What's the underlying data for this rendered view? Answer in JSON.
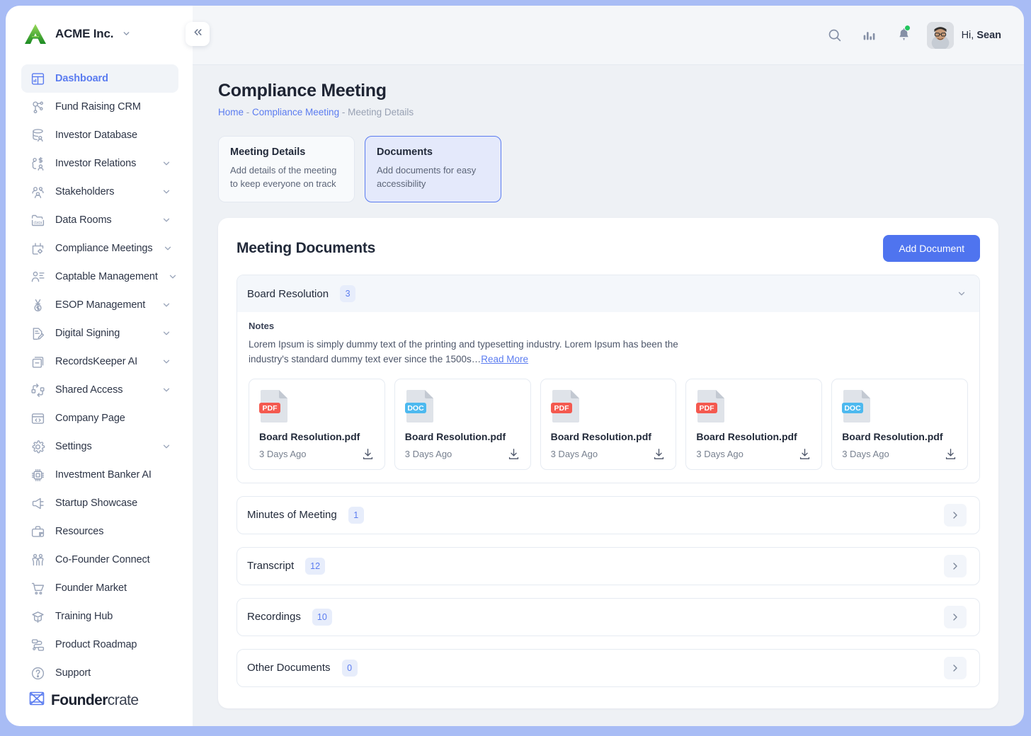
{
  "brand": {
    "name": "ACME Inc.",
    "logo_icon": "acme-triangle-logo",
    "caret_icon": "chevron-down-icon"
  },
  "collapse_button": {
    "icon": "double-chevron-left-icon"
  },
  "sidebar": {
    "items": [
      {
        "label": "Dashboard",
        "icon": "dashboard-icon",
        "active": true,
        "expandable": false
      },
      {
        "label": "Fund Raising CRM",
        "icon": "network-nodes-icon",
        "active": false,
        "expandable": false
      },
      {
        "label": "Investor Database",
        "icon": "database-user-icon",
        "active": false,
        "expandable": false
      },
      {
        "label": "Investor Relations",
        "icon": "people-currency-icon",
        "active": false,
        "expandable": true
      },
      {
        "label": "Stakeholders",
        "icon": "group-people-icon",
        "active": false,
        "expandable": true
      },
      {
        "label": "Data Rooms",
        "icon": "data-folder-icon",
        "active": false,
        "expandable": true
      },
      {
        "label": "Compliance Meetings",
        "icon": "calendar-gear-icon",
        "active": false,
        "expandable": true
      },
      {
        "label": "Captable Management",
        "icon": "person-list-icon",
        "active": false,
        "expandable": true
      },
      {
        "label": "ESOP Management",
        "icon": "medal-dollar-icon",
        "active": false,
        "expandable": true
      },
      {
        "label": "Digital Signing",
        "icon": "document-pen-icon",
        "active": false,
        "expandable": true
      },
      {
        "label": "RecordsKeeper AI",
        "icon": "archive-box-icon",
        "active": false,
        "expandable": true
      },
      {
        "label": "Shared Access",
        "icon": "share-arrows-icon",
        "active": false,
        "expandable": true
      },
      {
        "label": "Company Page",
        "icon": "browser-code-icon",
        "active": false,
        "expandable": false
      },
      {
        "label": "Settings",
        "icon": "gear-icon",
        "active": false,
        "expandable": true
      },
      {
        "label": "Investment Banker AI",
        "icon": "chip-ai-icon",
        "active": false,
        "expandable": false
      },
      {
        "label": "Startup Showcase",
        "icon": "megaphone-icon",
        "active": false,
        "expandable": false
      },
      {
        "label": "Resources",
        "icon": "briefcase-icon",
        "active": false,
        "expandable": false
      },
      {
        "label": "Co-Founder Connect",
        "icon": "two-persons-icon",
        "active": false,
        "expandable": false
      },
      {
        "label": "Founder Market",
        "icon": "shopping-cart-icon",
        "active": false,
        "expandable": false
      },
      {
        "label": "Training Hub",
        "icon": "graduation-cap-icon",
        "active": false,
        "expandable": false
      },
      {
        "label": "Product Roadmap",
        "icon": "roadmap-flow-icon",
        "active": false,
        "expandable": false
      },
      {
        "label": "Support",
        "icon": "question-circle-icon",
        "active": false,
        "expandable": false
      }
    ],
    "footer_logo": {
      "bold": "Founder",
      "light": "crate",
      "icon": "crate-box-icon"
    }
  },
  "topbar": {
    "search_icon": "search-icon",
    "analytics_icon": "bar-chart-icon",
    "notifications_icon": "bell-icon",
    "has_notification_dot": true,
    "avatar_icon": "avatar",
    "greeting_prefix": "Hi, ",
    "user_name": "Sean"
  },
  "page": {
    "title": "Compliance Meeting",
    "breadcrumb": {
      "home": "Home",
      "sep1": " - ",
      "section": "Compliance Meeting",
      "sep2": " - ",
      "current": "Meeting Details"
    }
  },
  "steps": [
    {
      "title": "Meeting Details",
      "desc": "Add details of the meeting to keep everyone on track",
      "selected": false
    },
    {
      "title": "Documents",
      "desc": "Add documents for easy accessibility",
      "selected": true
    }
  ],
  "documents_card": {
    "title": "Meeting Documents",
    "add_button": "Add Document",
    "sections": [
      {
        "label": "Board Resolution",
        "count": "3",
        "open": true,
        "toggle_icon": "chevron-down-icon",
        "notes_label": "Notes",
        "notes_text": "Lorem Ipsum is simply dummy text of the printing and typesetting industry. Lorem Ipsum has been the industry's standard dummy text ever since the 1500s…",
        "read_more": "Read More",
        "files": [
          {
            "type": "PDF",
            "name": "Board Resolution.pdf",
            "time": "3 Days Ago",
            "download_icon": "download-icon"
          },
          {
            "type": "DOC",
            "name": "Board Resolution.pdf",
            "time": "3 Days Ago",
            "download_icon": "download-icon"
          },
          {
            "type": "PDF",
            "name": "Board Resolution.pdf",
            "time": "3 Days Ago",
            "download_icon": "download-icon"
          },
          {
            "type": "PDF",
            "name": "Board Resolution.pdf",
            "time": "3 Days Ago",
            "download_icon": "download-icon"
          },
          {
            "type": "DOC",
            "name": "Board Resolution.pdf",
            "time": "3 Days Ago",
            "download_icon": "download-icon"
          }
        ]
      },
      {
        "label": "Minutes of Meeting",
        "count": "1",
        "open": false,
        "toggle_icon": "chevron-right-icon"
      },
      {
        "label": "Transcript",
        "count": "12",
        "open": false,
        "toggle_icon": "chevron-right-icon"
      },
      {
        "label": "Recordings",
        "count": "10",
        "open": false,
        "toggle_icon": "chevron-right-icon"
      },
      {
        "label": "Other Documents",
        "count": "0",
        "open": false,
        "toggle_icon": "chevron-right-icon"
      }
    ]
  },
  "colors": {
    "accent": "#4f74ef",
    "accent_text": "#5b7cf0",
    "frame": "#a8bcf5",
    "app_bg": "#eef1f5",
    "pdf_badge": "#f4594f",
    "doc_badge": "#4db9ef",
    "notification_dot": "#22c55e"
  }
}
